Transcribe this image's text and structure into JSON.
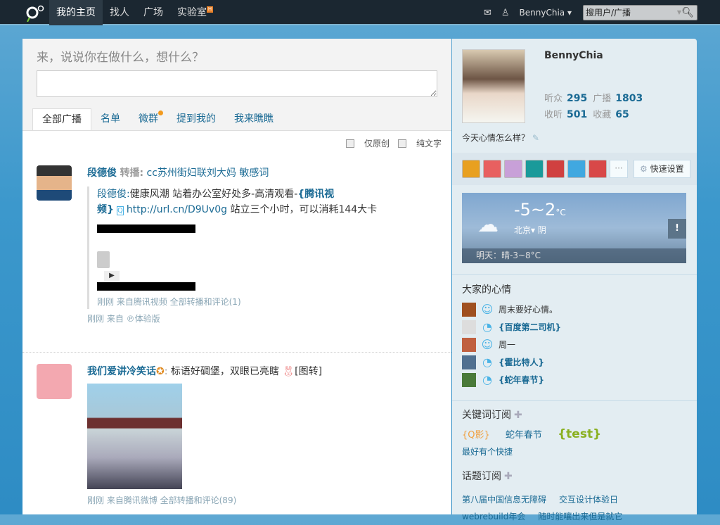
{
  "nav": {
    "items": [
      "我的主页",
      "找人",
      "广场",
      "实验室"
    ],
    "lab_badge": "H",
    "username": "BennyChia",
    "search_placeholder": "搜用户/广播"
  },
  "composer": {
    "prompt": "来，说说你在做什么，想什么？"
  },
  "tabs": [
    "全部广播",
    "名单",
    "微群",
    "提到我的",
    "我来瞧瞧"
  ],
  "filters": [
    "仅原创",
    "纯文字"
  ],
  "posts": [
    {
      "author": "段德俊",
      "action": "转播:",
      "text": "cc苏州街妇联刘大妈 敏感词",
      "quote": {
        "author": "段德俊:",
        "text": "健康风潮 站着办公室好处多-高清观看-",
        "tag": "{腾讯视频}",
        "link": "http://url.cn/D9Uv0g",
        "text2": " 站立三个小时，可以消耗144大卡",
        "meta": "刚刚 来自腾讯视频 全部转播和评论(1)"
      },
      "meta": "刚刚 来自",
      "meta2": "体验版"
    },
    {
      "author": "我们爱讲冷笑话",
      "text": "标语好碉堡，双眼已亮瞎 ",
      "tail": "[图转]",
      "meta": "刚刚 来自腾讯微博 全部转播和评论(89)"
    }
  ],
  "profile": {
    "name": "BennyChia",
    "stats": [
      {
        "label": "听众",
        "value": "295"
      },
      {
        "label": "广播",
        "value": "1803"
      },
      {
        "label": "收听",
        "value": "501"
      },
      {
        "label": "收藏",
        "value": "65"
      }
    ],
    "mood_prompt": "今天心情怎么样？",
    "more": "···",
    "quick_settings": "快速设置"
  },
  "weather": {
    "temp": "-5~2",
    "unit": "°C",
    "city": "北京",
    "cond": "阴",
    "warn": "!",
    "tomorrow": "明天：晴-3~8°C"
  },
  "moods": {
    "title": "大家的心情",
    "items": [
      {
        "text": "周末要好心情。",
        "type": "smile"
      },
      {
        "text": "{百度第二司机}",
        "type": "rss"
      },
      {
        "text": "周一",
        "type": "face"
      },
      {
        "text": "{霍比特人}",
        "type": "rss"
      },
      {
        "text": "{蛇年春节}",
        "type": "rss"
      }
    ]
  },
  "keywords": {
    "title": "关键词订阅",
    "items": [
      "{Q影}",
      "蛇年春节",
      "{test}",
      "最好有个快捷"
    ]
  },
  "topics": {
    "title": "话题订阅",
    "items": [
      "第八届中国信息无障碍",
      "交互设计体验日",
      "webrebuild年会",
      "随时能嚷出来但是就它"
    ]
  },
  "colors": {
    "link": "#1a6a94",
    "topbar": "#1b2731"
  }
}
